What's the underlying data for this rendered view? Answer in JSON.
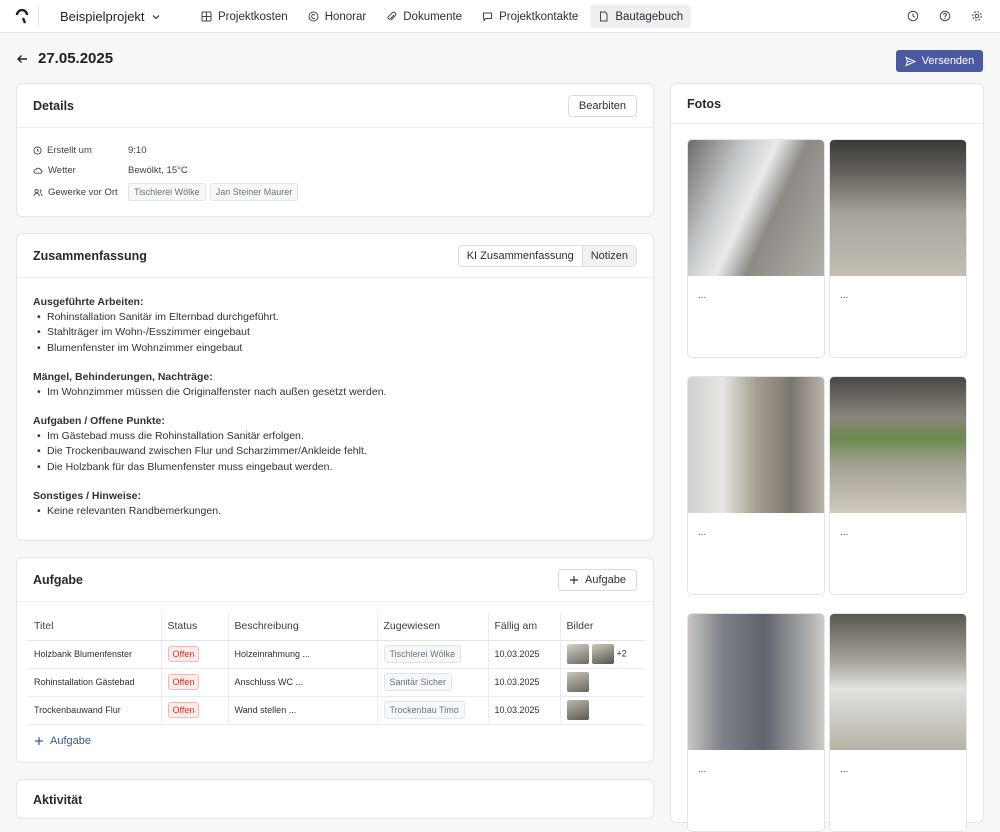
{
  "topbar": {
    "project": "Beispielprojekt",
    "nav": [
      "Projektkosten",
      "Honorar",
      "Dokumente",
      "Projektkontakte",
      "Bautagebuch"
    ]
  },
  "header": {
    "date": "27.05.2025",
    "send_label": "Versenden"
  },
  "details": {
    "title": "Details",
    "edit_label": "Bearbiten",
    "created_label": "Erstellt um",
    "created_value": "9:10",
    "weather_label": "Wetter",
    "weather_value": "Bewölkt, 15°C",
    "trades_label": "Gewerke vor Ort",
    "trades": [
      "Tischlerei Wölke",
      "Jan Steiner Maurer"
    ]
  },
  "summary": {
    "title": "Zusammenfassung",
    "tab_ai": "KI Zusammenfassung",
    "tab_notes": "Notizen",
    "sections": [
      {
        "heading": "Ausgeführte Arbeiten:",
        "items": [
          "Rohinstallation Sanitär im Elternbad durchgeführt.",
          "Stahlträger im Wohn-/Esszimmer eingebaut",
          "Blumenfenster im Wohnzimmer eingebaut"
        ]
      },
      {
        "heading": "Mängel, Behinderungen, Nachträge:",
        "items": [
          "Im Wohnzimmer müssen die Originalfenster nach außen gesetzt werden."
        ]
      },
      {
        "heading": "Aufgaben / Offene Punkte:",
        "items": [
          "Im Gästebad muss die Rohinstallation Sanitär erfolgen.",
          "Die Trockenbauwand zwischen Flur und Scharzimmer/Ankleide fehlt.",
          "Die Holzbank für das Blumenfenster muss eingebaut werden."
        ]
      },
      {
        "heading": "Sonstiges / Hinweise:",
        "items": [
          "Keine relevanten Randbemerkungen."
        ]
      }
    ]
  },
  "tasks": {
    "title": "Aufgabe",
    "add_label": "Aufgabe",
    "columns": [
      "Titel",
      "Status",
      "Beschreibung",
      "Zugewiesen",
      "Fällig am",
      "Bilder"
    ],
    "rows": [
      {
        "title": "Holzbank Blumenfenster",
        "status": "Offen",
        "desc": "Holzeinrahmung ...",
        "assignee": "Tischlerei Wölke",
        "due": "10.03.2025",
        "extra": "+2"
      },
      {
        "title": "Rohinstallation Gästebad",
        "status": "Offen",
        "desc": "Anschluss WC  ...",
        "assignee": "Sanitär Sicher",
        "due": "10.03.2025",
        "extra": ""
      },
      {
        "title": "Trockenbauwand Flur",
        "status": "Offen",
        "desc": "Wand stellen ...",
        "assignee": "Trockenbau Timo",
        "due": "10.03.2025",
        "extra": ""
      }
    ],
    "add_link": "Aufgabe"
  },
  "activity": {
    "title": "Aktivität"
  },
  "photos": {
    "title": "Fotos",
    "captions": [
      "...",
      "...",
      "...",
      "...",
      "...",
      "..."
    ]
  },
  "colors": {
    "accent": "#4b5aa0",
    "status_red": "#c0392b",
    "link_blue": "#3b56a8"
  }
}
